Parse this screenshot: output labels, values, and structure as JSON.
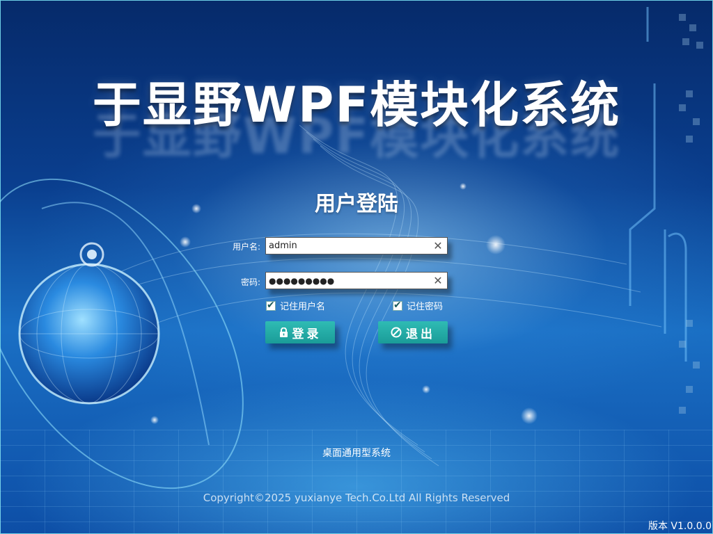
{
  "app": {
    "title": "于显野WPF模块化系统",
    "login_heading": "用户登陆",
    "subtitle": "桌面通用型系统",
    "copyright": "Copyright©2025 yuxianye Tech.Co.Ltd All Rights Reserved",
    "version": "版本 V1.0.0.0"
  },
  "form": {
    "username_label": "用户名:",
    "username_value": "admin",
    "password_label": "密码:",
    "password_value": "●●●●●●●●●",
    "clear_symbol": "✕",
    "remember_username_label": "记住用户名",
    "remember_password_label": "记住密码",
    "remember_username_checked": true,
    "remember_password_checked": true,
    "check_symbol": "✔"
  },
  "buttons": {
    "login_label": "登录",
    "login_icon": "lock-icon",
    "exit_label": "退出",
    "exit_icon": "forbidden-icon"
  },
  "colors": {
    "button": "#2fbcb4",
    "background": "#0a3f8f",
    "selection": "#8fc8c0"
  }
}
